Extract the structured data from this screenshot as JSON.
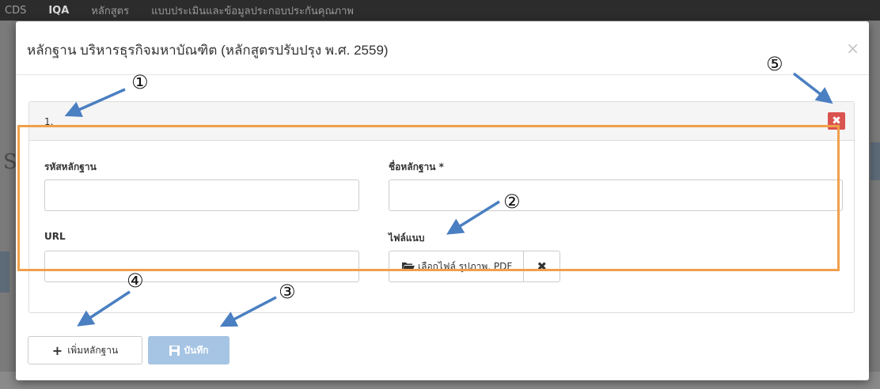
{
  "background": {
    "nav_items": [
      "CDS",
      "IQA",
      "หลักสูตร",
      "แบบประเมินและข้อมูลประกอบประกันคุณภาพ"
    ],
    "left_letter": "S"
  },
  "modal": {
    "title": "หลักฐาน บริหารธุรกิจมหาบัณฑิต (หลักสูตรปรับปรุง พ.ศ. 2559)",
    "close_symbol": "×"
  },
  "evidence": {
    "number": "1.",
    "delete_symbol": "✖",
    "code_label": "รหัสหลักฐาน",
    "code_value": "",
    "name_label": "ชื่อหลักฐาน *",
    "name_value": "",
    "url_label": "URL",
    "url_value": "",
    "attach_label": "ไฟล์แนบ",
    "choose_file_label": "เลือกไฟล์ รูปภาพ, PDF",
    "clear_file_symbol": "✖"
  },
  "footer": {
    "add_label": "เพิ่มหลักฐาน",
    "add_icon": "+",
    "save_label": "บันทึก",
    "save_icon": "floppy-disk-icon"
  },
  "annotations": [
    "①",
    "②",
    "③",
    "④",
    "⑤"
  ],
  "colors": {
    "highlight_border": "#f0a04b",
    "arrow": "#4a7fc1",
    "danger": "#d9534f",
    "primary_disabled": "#a6c4e3"
  }
}
